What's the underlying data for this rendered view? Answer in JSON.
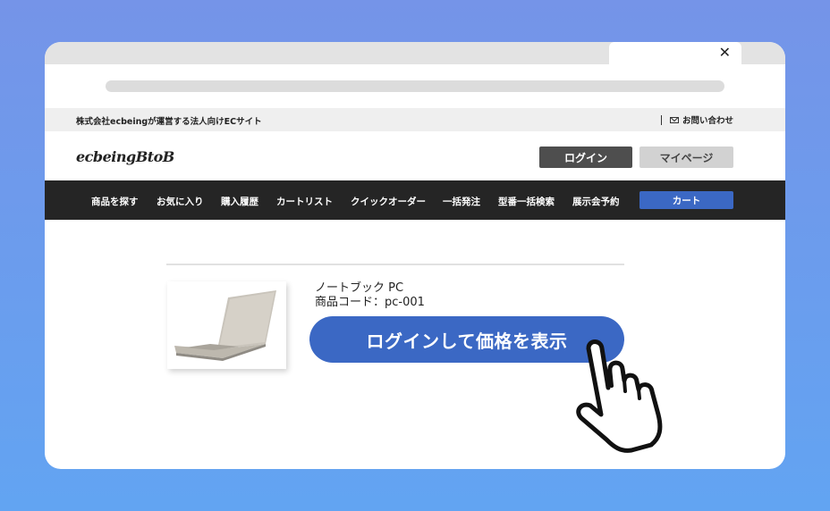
{
  "browser": {
    "tab_close_glyph": "✕"
  },
  "site": {
    "company_text": "株式会社ecbeingが運営する法人向けECサイト",
    "contact_label": "お問い合わせ",
    "logo_text": "ecbeingBtoB"
  },
  "header": {
    "login_label": "ログイン",
    "mypage_label": "マイページ"
  },
  "nav": {
    "items": [
      {
        "label": "商品を探す"
      },
      {
        "label": "お気に入り"
      },
      {
        "label": "購入履歴"
      },
      {
        "label": "カートリスト"
      },
      {
        "label": "クイックオーダー"
      },
      {
        "label": "一括発注"
      },
      {
        "label": "型番一括検索"
      },
      {
        "label": "展示会予約"
      }
    ],
    "cart_label": "カート"
  },
  "product": {
    "name": "ノートブック PC",
    "code": "商品コード：pc-001",
    "show_price_label": "ログインして価格を表示"
  },
  "colors": {
    "accent": "#3b68c4",
    "nav_bg": "#252525",
    "background_top": "#7594e8",
    "background_bottom": "#62a4f2"
  },
  "icons": {
    "mail": "mail-icon",
    "pointer": "hand-pointer-icon",
    "product": "laptop-icon"
  }
}
